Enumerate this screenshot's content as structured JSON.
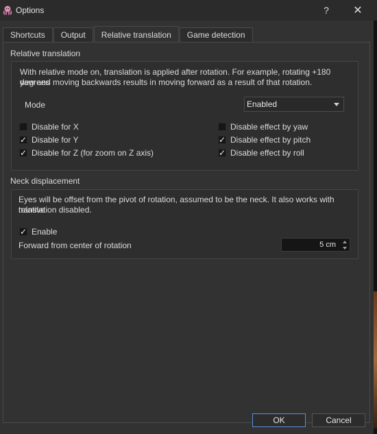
{
  "window": {
    "title": "Options",
    "help": "?",
    "close": "✕"
  },
  "tabs": [
    {
      "label": "Shortcuts"
    },
    {
      "label": "Output"
    },
    {
      "label": "Relative translation"
    },
    {
      "label": "Game detection"
    }
  ],
  "relative": {
    "title": "Relative translation",
    "description_line1": "With relative mode on, translation is applied after rotation. For example, rotating +180 degrees",
    "description_line2": "yaw and moving backwards results in moving forward as a result of that rotation.",
    "mode_label": "Mode",
    "mode_value": "Enabled",
    "checks": {
      "disable_x": {
        "label": "Disable for X",
        "checked": false
      },
      "disable_y": {
        "label": "Disable for Y",
        "checked": true
      },
      "disable_z": {
        "label": "Disable for Z (for zoom on Z axis)",
        "checked": true
      },
      "disable_yaw": {
        "label": "Disable effect by yaw",
        "checked": false
      },
      "disable_pitch": {
        "label": "Disable effect by pitch",
        "checked": true
      },
      "disable_roll": {
        "label": "Disable effect by roll",
        "checked": true
      }
    }
  },
  "neck": {
    "title": "Neck displacement",
    "description_line1": "Eyes will be offset from the pivot of rotation, assumed to be the neck. It also works with relative",
    "description_line2": "translation disabled.",
    "enable": {
      "label": "Enable",
      "checked": true
    },
    "forward_label": "Forward from center of rotation",
    "forward_value": "5 cm"
  },
  "buttons": {
    "ok": "OK",
    "cancel": "Cancel"
  },
  "checkmark": "✓"
}
